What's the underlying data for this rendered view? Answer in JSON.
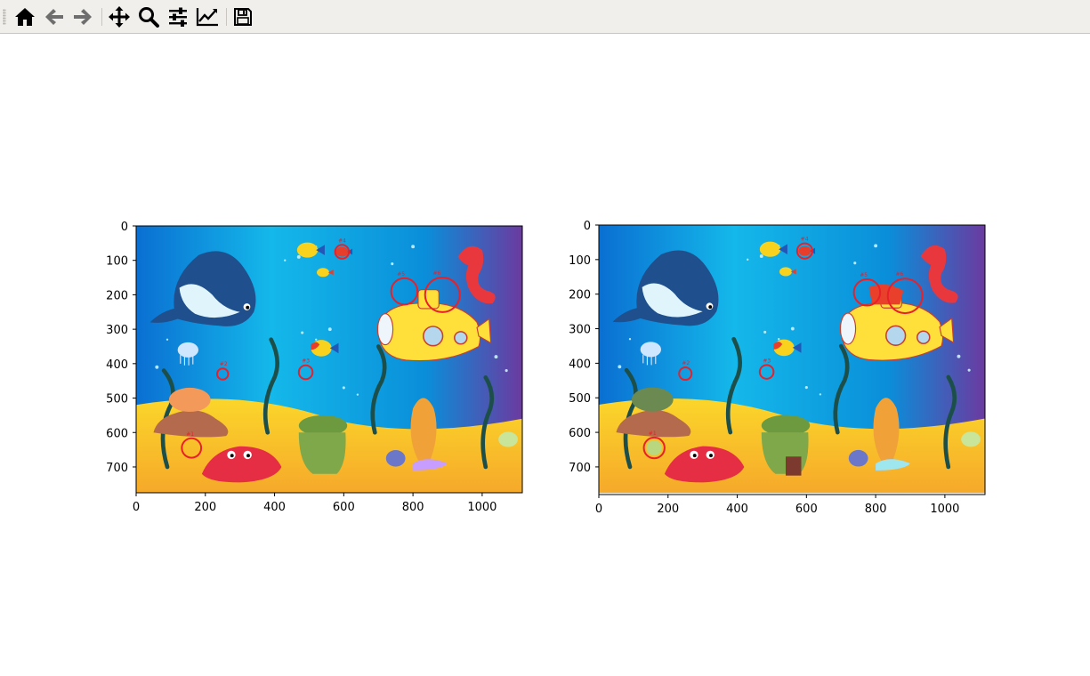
{
  "toolbar": {
    "buttons": [
      {
        "name": "home-button",
        "icon": "home-icon",
        "enabled": true
      },
      {
        "name": "back-button",
        "icon": "arrow-left-icon",
        "enabled": false
      },
      {
        "name": "forward-button",
        "icon": "arrow-right-icon",
        "enabled": false
      },
      {
        "name": "pan-button",
        "icon": "move-icon",
        "enabled": true
      },
      {
        "name": "zoom-button",
        "icon": "magnifier-icon",
        "enabled": true
      },
      {
        "name": "configure-subplots-button",
        "icon": "sliders-icon",
        "enabled": true
      },
      {
        "name": "edit-axis-button",
        "icon": "line-chart-icon",
        "enabled": true
      },
      {
        "name": "save-button",
        "icon": "floppy-disk-icon",
        "enabled": true
      }
    ]
  },
  "figure": {
    "panels": [
      {
        "name": "left-image",
        "x_ticks": [
          "0",
          "200",
          "400",
          "600",
          "800",
          "1000"
        ],
        "y_ticks": [
          "0",
          "100",
          "200",
          "300",
          "400",
          "500",
          "600",
          "700"
        ],
        "xlim": [
          0,
          1116
        ],
        "ylim": [
          775,
          0
        ],
        "markers": [
          {
            "label": "#1",
            "x": 160,
            "y": 645,
            "r": 28
          },
          {
            "label": "#2",
            "x": 250,
            "y": 430,
            "r": 16
          },
          {
            "label": "#3",
            "x": 490,
            "y": 425,
            "r": 20
          },
          {
            "label": "#4",
            "x": 595,
            "y": 75,
            "r": 20
          },
          {
            "label": "#5",
            "x": 775,
            "y": 190,
            "r": 38
          },
          {
            "label": "#6",
            "x": 885,
            "y": 200,
            "r": 50
          }
        ]
      },
      {
        "name": "right-image",
        "x_ticks": [
          "0",
          "200",
          "400",
          "600",
          "800",
          "1000"
        ],
        "y_ticks": [
          "0",
          "100",
          "200",
          "300",
          "400",
          "500",
          "600",
          "700"
        ],
        "xlim": [
          0,
          1116
        ],
        "ylim": [
          780,
          0
        ],
        "markers": [
          {
            "label": "#1",
            "x": 160,
            "y": 645,
            "r": 30
          },
          {
            "label": "#2",
            "x": 250,
            "y": 430,
            "r": 18
          },
          {
            "label": "#3",
            "x": 485,
            "y": 425,
            "r": 20
          },
          {
            "label": "#4",
            "x": 595,
            "y": 75,
            "r": 22
          },
          {
            "label": "#5",
            "x": 775,
            "y": 195,
            "r": 38
          },
          {
            "label": "#6",
            "x": 885,
            "y": 205,
            "r": 50
          }
        ]
      }
    ]
  },
  "colors": {
    "marker": "#e8202a",
    "water_top": "#0b8fd8",
    "water_mid": "#12b9ea",
    "sand": "#f9c825",
    "sand_dark": "#f5a524",
    "whale": "#1f4f8c",
    "submarine": "#ffe03a",
    "crab": "#e52d44",
    "seahorse": "#e8383e"
  }
}
